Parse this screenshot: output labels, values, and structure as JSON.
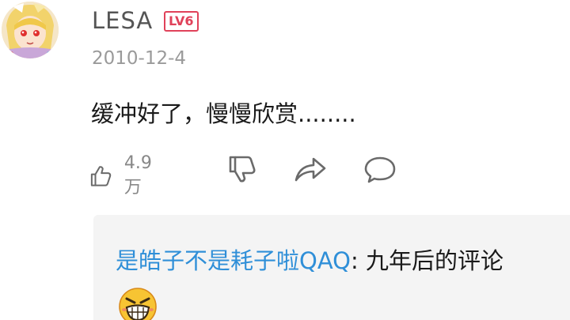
{
  "comment": {
    "username": "LESA",
    "level_badge": "LV6",
    "date": "2010-12-4",
    "text": "缓冲好了，慢慢欣赏........",
    "like_count": "4.9万",
    "icons": {
      "like": "thumbs-up-icon",
      "dislike": "thumbs-down-icon",
      "share": "share-icon",
      "reply": "comment-icon"
    },
    "colors": {
      "username": "#555555",
      "level_badge": "#e0425a",
      "date": "#9a9a9a",
      "reply_user": "#2f8fd8",
      "reply_background": "#f4f4f4"
    }
  },
  "reply": {
    "username": "是皓子不是耗子啦QAQ",
    "separator": ": ",
    "text": "九年后的评论",
    "emoji": "grinning-emoji"
  }
}
